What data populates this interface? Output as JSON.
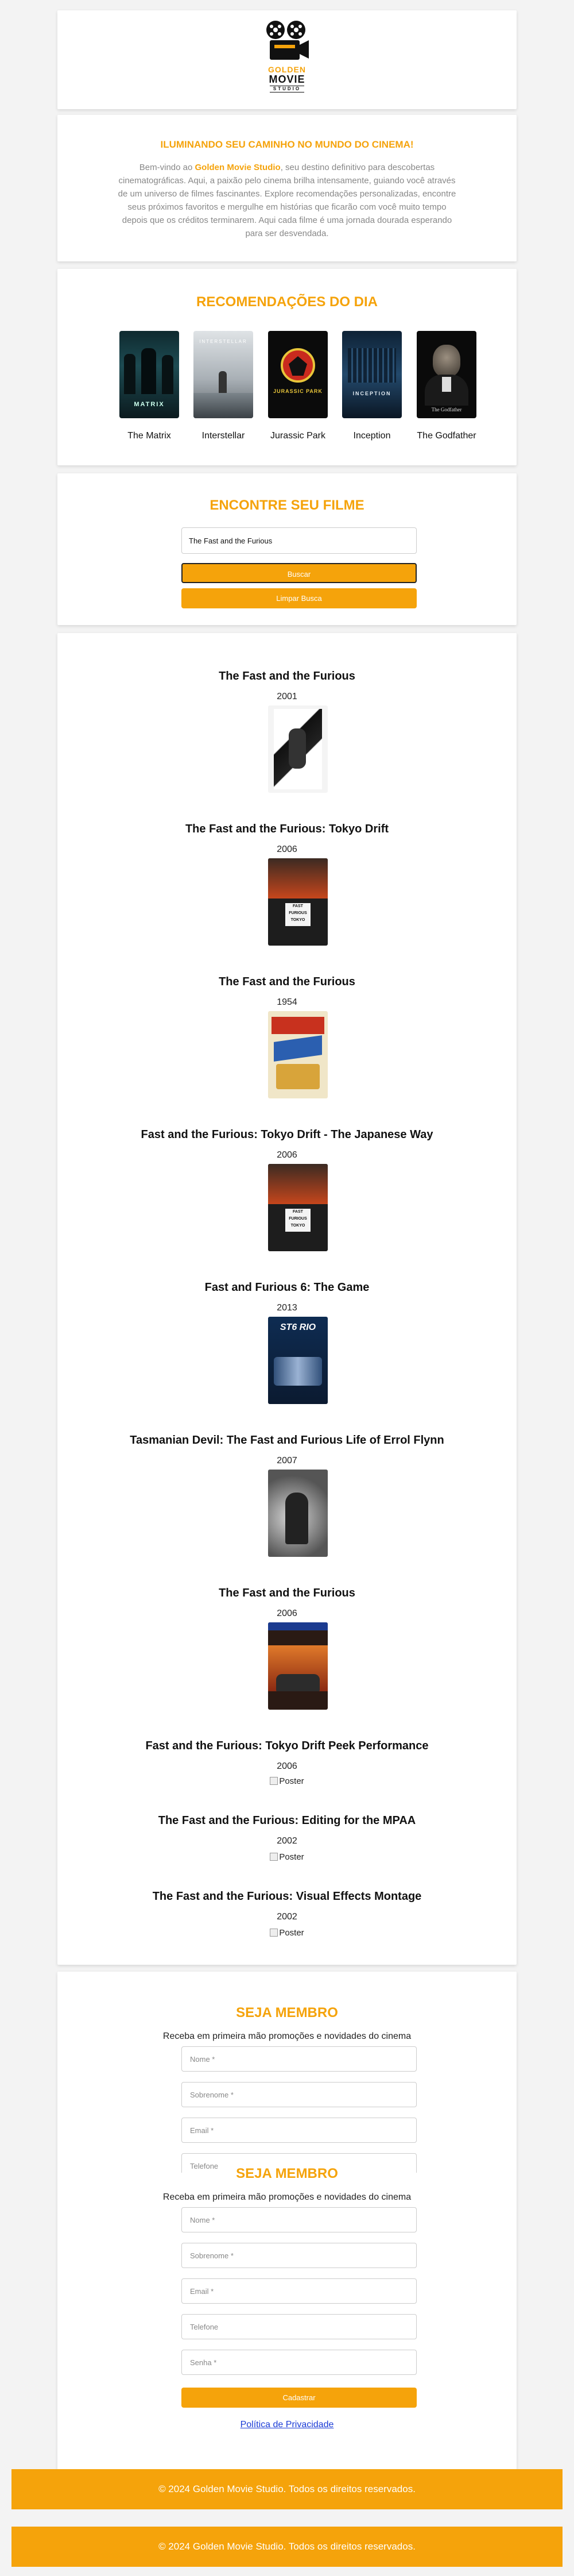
{
  "brand": {
    "logo_line1": "GOLDEN",
    "logo_line2": "MOVIE",
    "logo_line3": "STUDIO",
    "gold": "#f5a30b"
  },
  "welcome": {
    "title": "ILUMINANDO SEU CAMINHO NO MUNDO DO CINEMA!",
    "text_before": "Bem-vindo ao ",
    "brand_name": "Golden Movie Studio",
    "text_after": ", seu destino definitivo para descobertas cinematográficas. Aqui, a paixão pelo cinema brilha intensamente, guiando você através de um universo de filmes fascinantes. Explore recomendações personalizadas, encontre seus próximos favoritos e mergulhe em histórias que ficarão com você muito tempo depois que os créditos terminarem. Aqui cada filme é uma jornada dourada esperando para ser desvendada."
  },
  "recommendations": {
    "title": "RECOMENDAÇÕES DO DIA",
    "items": [
      {
        "label": "The Matrix",
        "poster_title": "MATRIX"
      },
      {
        "label": "Interstellar",
        "poster_title": "INTERSTELLAR"
      },
      {
        "label": "Jurassic Park",
        "poster_title": "JURASSIC PARK"
      },
      {
        "label": "Inception",
        "poster_title": "INCEPTION"
      },
      {
        "label": "The Godfather",
        "poster_title": "The Godfather"
      }
    ]
  },
  "search": {
    "title": "ENCONTRE SEU FILME",
    "input_value": "The Fast and the Furious",
    "search_button": "Buscar",
    "clear_button": "Limpar Busca"
  },
  "results": [
    {
      "title": "The Fast and the Furious",
      "year": "2001",
      "poster": "fast-2001"
    },
    {
      "title": "The Fast and the Furious: Tokyo Drift",
      "year": "2006",
      "poster": "tokyo-drift"
    },
    {
      "title": "The Fast and the Furious",
      "year": "1954",
      "poster": "fast-1954"
    },
    {
      "title": "Fast and the Furious: Tokyo Drift - The Japanese Way",
      "year": "2006",
      "poster": "tokyo-drift"
    },
    {
      "title": "Fast and Furious 6: The Game",
      "year": "2013",
      "poster": "ff6-game"
    },
    {
      "title": "Tasmanian Devil: The Fast and Furious Life of Errol Flynn",
      "year": "2007",
      "poster": "errol-flynn"
    },
    {
      "title": "The Fast and the Furious",
      "year": "2006",
      "poster": "ps2"
    },
    {
      "title": "Fast and the Furious: Tokyo Drift Peek Performance",
      "year": "2006",
      "poster": "broken"
    },
    {
      "title": "The Fast and the Furious: Editing for the MPAA",
      "year": "2002",
      "poster": "broken"
    },
    {
      "title": "The Fast and the Furious: Visual Effects Montage",
      "year": "2002",
      "poster": "broken"
    }
  ],
  "broken_image_alt": "Poster",
  "membership": {
    "title": "SEJA MEMBRO",
    "subtitle": "Receba em primeira mão promoções e novidades do cinema",
    "fields": {
      "name": "Nome  *",
      "surname": "Sobrenome  *",
      "email": "Email  *",
      "phone": "Telefone",
      "password": "Senha  *"
    },
    "submit": "Cadastrar",
    "privacy_link": "Política de Privacidade"
  },
  "footer": {
    "text": "© 2024 Golden Movie Studio. Todos os direitos reservados."
  }
}
